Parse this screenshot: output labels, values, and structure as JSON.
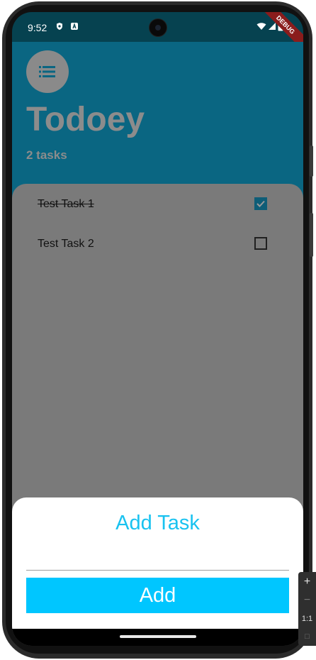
{
  "status_bar": {
    "time": "9:52",
    "icons": [
      "shield-icon",
      "a-badge-icon",
      "wifi-icon",
      "signal-icon",
      "battery-icon"
    ],
    "debug_banner": "DEBUG"
  },
  "header": {
    "menu_icon": "list-icon",
    "title": "Todoey",
    "task_count": "2 tasks"
  },
  "tasks": [
    {
      "label": "Test Task 1",
      "done": true
    },
    {
      "label": "Test Task 2",
      "done": false
    }
  ],
  "sheet": {
    "title": "Add Task",
    "input_value": "",
    "add_label": "Add"
  },
  "emulator_toolbar": {
    "items": [
      "+",
      "−",
      "1:1",
      "□"
    ]
  },
  "colors": {
    "header_bg": "#0a6682",
    "accent": "#19c2f0",
    "button": "#00c6ff",
    "checkbox_checked": "#0e5d77"
  }
}
